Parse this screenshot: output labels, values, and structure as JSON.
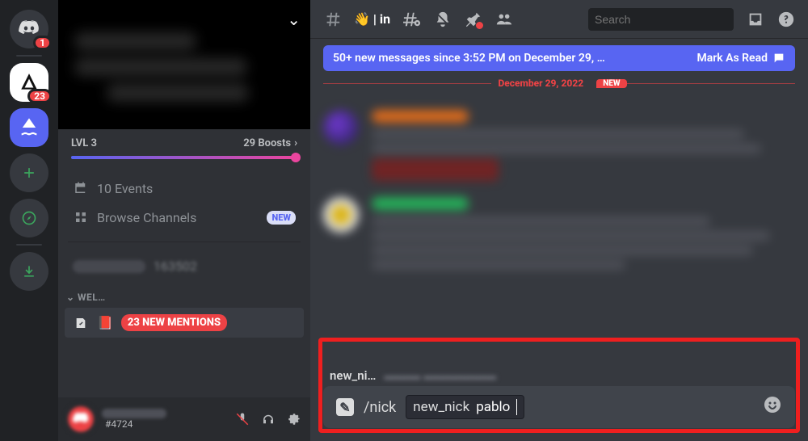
{
  "rail": {
    "home_badge": "1",
    "server2_badge": "23"
  },
  "sidebar": {
    "level_label": "LVL 3",
    "boost_count": "29 Boosts",
    "events_label": "10 Events",
    "browse_label": "Browse Channels",
    "browse_new": "NEW",
    "members_count": "163502",
    "category": "WEL…",
    "mentions_pill": "23 NEW MENTIONS",
    "user_discrim": "#4724"
  },
  "topbar": {
    "channel_prefix": "👋 | in",
    "search_placeholder": "Search"
  },
  "unread": {
    "text": "50+ new messages since 3:52 PM on December 29, …",
    "mark": "Mark As Read"
  },
  "divider": {
    "date": "December 29, 2022",
    "new": "NEW"
  },
  "command": {
    "hint_param": "new_ni…",
    "slash": "/nick",
    "param_name": "new_nick",
    "param_value": "pablo"
  }
}
